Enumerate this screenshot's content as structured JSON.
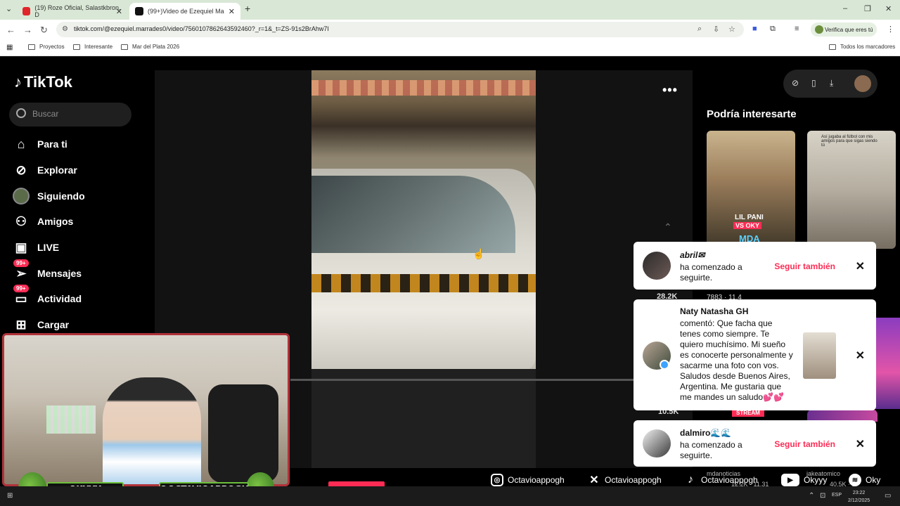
{
  "browser": {
    "tabs": [
      {
        "label": "(19) Roze Oficial, Salastkbron, D",
        "active": false,
        "favicon_color": "#e0262b"
      },
      {
        "label": "(99+)Video de Ezequiel Ma",
        "active": true,
        "favicon_color": "#111111"
      }
    ],
    "url": "tiktok.com/@ezequiel.marrades0/video/7560107862643592460?_r=1&_t=ZS-91s2BrAhw7I",
    "verify_pill": "Verifica que eres tú",
    "bookmarks": [
      "Proyectos",
      "Interesante",
      "Mar del Plata 2026"
    ],
    "all_bookmarks": "Todos los marcadores"
  },
  "tiktok": {
    "logo": "TikTok",
    "search_placeholder": "Buscar",
    "nav": [
      {
        "label": "Para ti",
        "icon": "home-icon"
      },
      {
        "label": "Explorar",
        "icon": "compass-icon"
      },
      {
        "label": "Siguiendo",
        "icon": "following-avatar"
      },
      {
        "label": "Amigos",
        "icon": "friends-icon"
      },
      {
        "label": "LIVE",
        "icon": "live-icon"
      },
      {
        "label": "Mensajes",
        "icon": "messages-icon",
        "badge": "99+"
      },
      {
        "label": "Actividad",
        "icon": "activity-icon",
        "badge": "99+"
      },
      {
        "label": "Cargar",
        "icon": "upload-icon"
      }
    ],
    "video_progress": 0.0,
    "recs_title": "Podría interesarte",
    "rec1": {
      "line1": "LIL PANI",
      "line2": "VS OKY",
      "line3": "MDA"
    },
    "rec2": {
      "top_text": "Así jugaba al fútbol con mis amigos para que sigas siendo tú"
    },
    "bg_counts": {
      "c1": "28.2K",
      "c2": "10.5K",
      "side": "7883 · 11.4",
      "stream": "STREAM"
    }
  },
  "notifications": [
    {
      "name": "abril✉",
      "message": "ha comenzado a seguirte.",
      "action": "Seguir también"
    },
    {
      "name": "Naty Natasha GH",
      "message": "comentó: Que facha que tenes como siempre. Te quiero muchísimo. Mi sueño es conocerte personalmente y sacarme una foto con vos. Saludos desde Buenos Aires, Argentina. Me gustaria que me mandes un saludo💕💕"
    },
    {
      "name": "dalmiro🌊🌊",
      "message": "ha comenzado a seguirte.",
      "action": "Seguir también"
    }
  ],
  "overlay": {
    "name1": "OKYYY",
    "name2": "@OCTAVIOAPPOGH",
    "socials": [
      {
        "icon": "instagram-icon",
        "label": "Octavioappogh"
      },
      {
        "icon": "x-icon",
        "label": "Octavioappogh"
      },
      {
        "icon": "tiktok-icon",
        "label": "Octavioappogh"
      },
      {
        "icon": "youtube-icon",
        "label": "Okyyy"
      },
      {
        "icon": "spotify-icon",
        "label": "Oky"
      }
    ],
    "ghost1": "mdanoticias",
    "ghost2": "jakeatomico",
    "ghost3": "12.2K · 11.31",
    "ghost4": "40.5K · 1"
  },
  "taskbar": {
    "lang": "ESP",
    "time": "23:22",
    "date": "2/12/2025"
  }
}
